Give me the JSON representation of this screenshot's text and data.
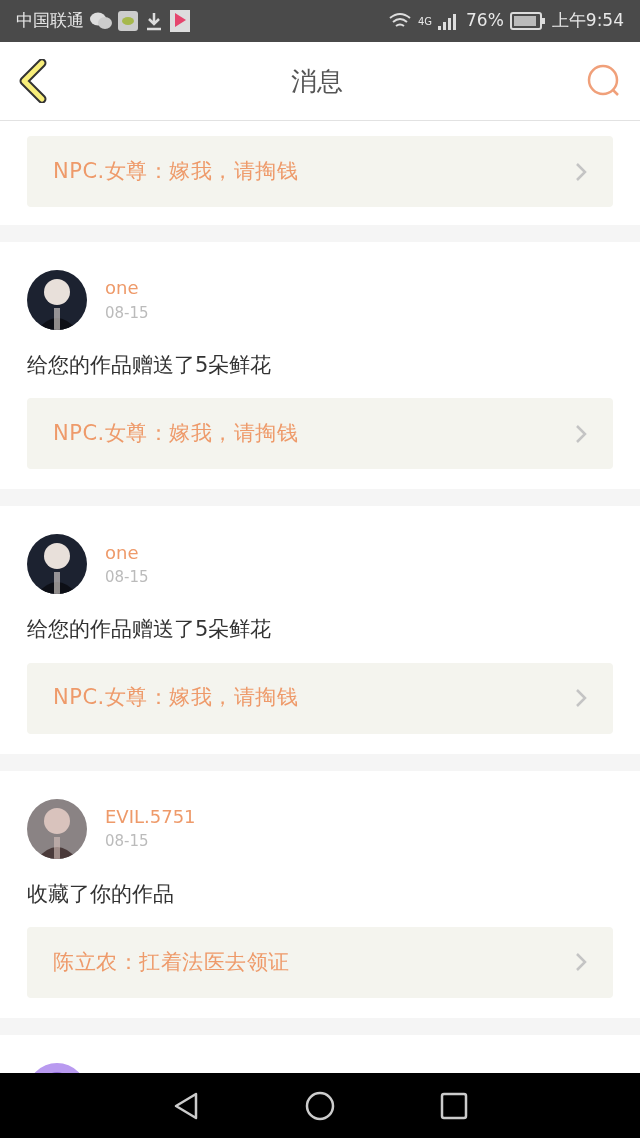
{
  "status_bar": {
    "carrier": "中国联通",
    "network": "4G",
    "battery": "76%",
    "time": "上午9:54"
  },
  "header": {
    "title": "消息"
  },
  "items": [
    {
      "kind": "partial",
      "quote": "NPC.女尊：嫁我，请掏钱"
    },
    {
      "kind": "full",
      "name": "one",
      "date": "08-15",
      "message": "给您的作品赠送了5朵鲜花",
      "quote": "NPC.女尊：嫁我，请掏钱"
    },
    {
      "kind": "full",
      "name": "one",
      "date": "08-15",
      "message": "给您的作品赠送了5朵鲜花",
      "quote": "NPC.女尊：嫁我，请掏钱"
    },
    {
      "kind": "full",
      "name": "EVIL.5751",
      "date": "08-15",
      "message": "收藏了你的作品",
      "quote": "陈立农：扛着法医去领证"
    },
    {
      "kind": "cut"
    }
  ]
}
